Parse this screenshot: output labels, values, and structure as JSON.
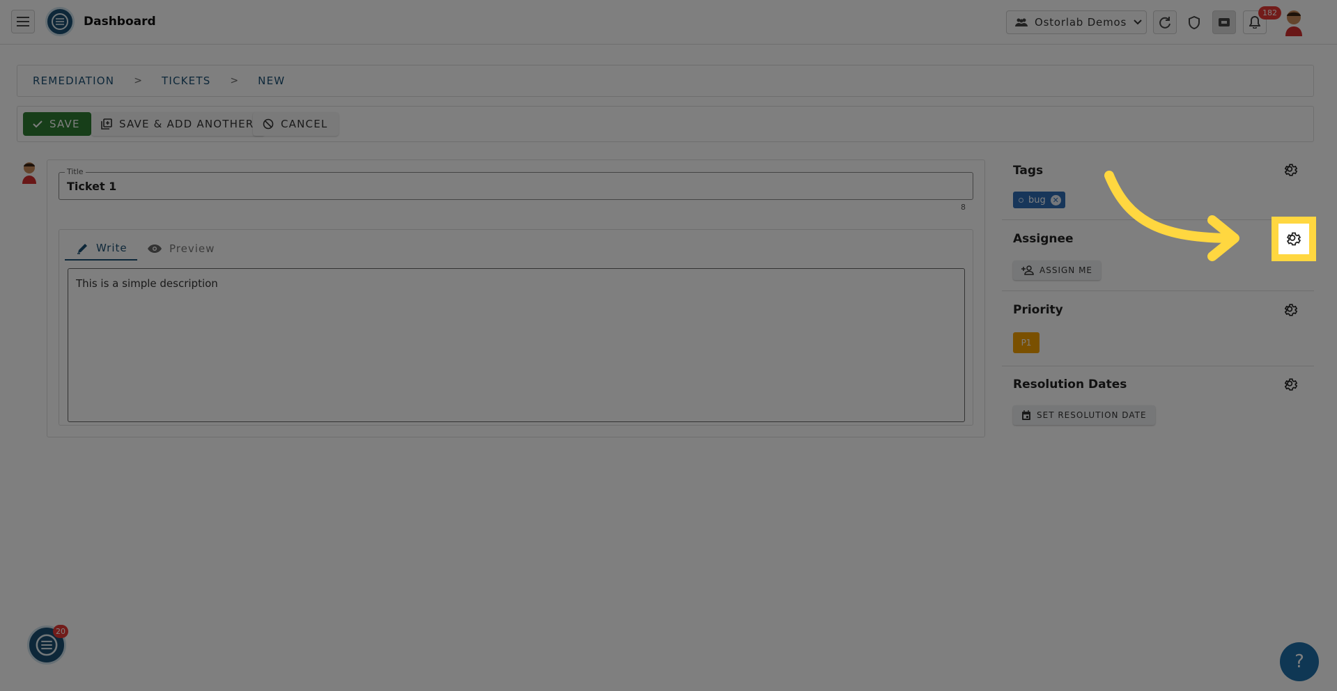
{
  "header": {
    "title": "Dashboard",
    "org_name": "Ostorlab Demos",
    "notification_count": "182"
  },
  "breadcrumb": [
    "REMEDIATION",
    ">",
    "TICKETS",
    ">",
    "NEW"
  ],
  "toolbar": {
    "save_label": "SAVE",
    "save_add_label": "SAVE & ADD ANOTHER",
    "cancel_label": "CANCEL"
  },
  "form": {
    "title_label": "Title",
    "title_value": "Ticket 1",
    "title_count": "8",
    "tab_write": "Write",
    "tab_preview": "Preview",
    "description": "This is a simple description"
  },
  "side": {
    "tags_label": "Tags",
    "tag_name": "bug",
    "assignee_label": "Assignee",
    "assign_me_label": "ASSIGN ME",
    "priority_label": "Priority",
    "priority_value": "P1",
    "resolution_label": "Resolution Dates",
    "set_resolution_label": "SET RESOLUTION DATE"
  },
  "floating": {
    "chat_badge": "20",
    "help_label": "?"
  },
  "colors": {
    "accent": "#1a4f73",
    "save_green": "#2e7d32",
    "tag_blue": "#2f6db5",
    "priority_orange": "#f5a000",
    "highlight_yellow": "#ffd740",
    "badge_red": "#e53935"
  }
}
